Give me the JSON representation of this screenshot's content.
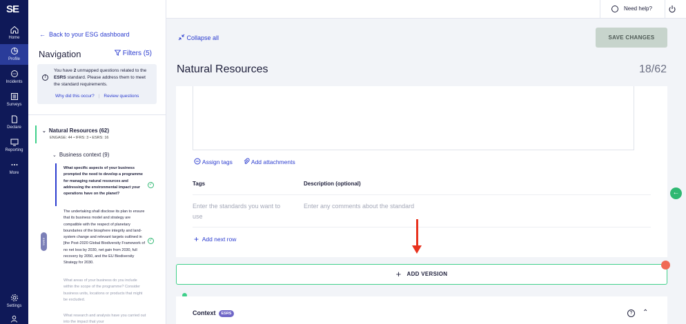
{
  "rail": {
    "logo": "SE",
    "items": [
      {
        "label": "Home"
      },
      {
        "label": "Profile"
      },
      {
        "label": "Incidents"
      },
      {
        "label": "Surveys"
      },
      {
        "label": "Declare"
      },
      {
        "label": "Reporting"
      },
      {
        "label": "More"
      },
      {
        "label": "Settings"
      }
    ]
  },
  "nav": {
    "back": "Back to your ESG dashboard",
    "title": "Navigation",
    "filters": "Filters (5)",
    "alert": {
      "text_before": "You have ",
      "count": "2",
      "text_mid": " unmapped questions related to the ",
      "standard": "ESRS",
      "text_after": " standard. Please address them to meet the standard requirements.",
      "why": "Why did this occur?",
      "review": "Review questions"
    },
    "section": {
      "title": "Natural Resources (62)",
      "sub": "ENGAGE: 44 • IFRS: 3 • ESRS: 16"
    },
    "context": "Business context (9)",
    "pill": "ESRS",
    "questions": [
      "What specific aspects of your business prompted the need to develop a programme for managing natural resources and addressing the environmental impact your operations have on the planet?",
      "The undertaking shall disclose its plan to ensure that its business model and strategy are compatible with the respect of planetary boundaries of the biosphere integrity and land-system change and relevant targets outlined in [the Post-2020 Global Biodiversity Framework of no net loss by 2030, net gain from 2030, full recovery by 2050, and the EU Biodiversity Strategy for 2030.",
      "What areas of your business do you include within the scope of the programme? Consider business units, locations or products that might be excluded.",
      "What research and analysis have you carried out into the impact that your"
    ]
  },
  "topbar": {
    "help": "Need help?"
  },
  "main": {
    "collapse": "Collapse all",
    "save": "SAVE CHANGES",
    "title": "Natural Resources",
    "count": "18/62",
    "assign_tags": "Assign tags",
    "add_attachments": "Add attachments",
    "table": {
      "col_tags": "Tags",
      "col_desc": "Description (optional)",
      "tags_placeholder": "Enter the standards you want to use",
      "desc_placeholder": "Enter any comments about the standard"
    },
    "add_row": "Add next row",
    "add_version": "ADD VERSION",
    "context_title": "Context",
    "context_badge": "ESRS"
  }
}
